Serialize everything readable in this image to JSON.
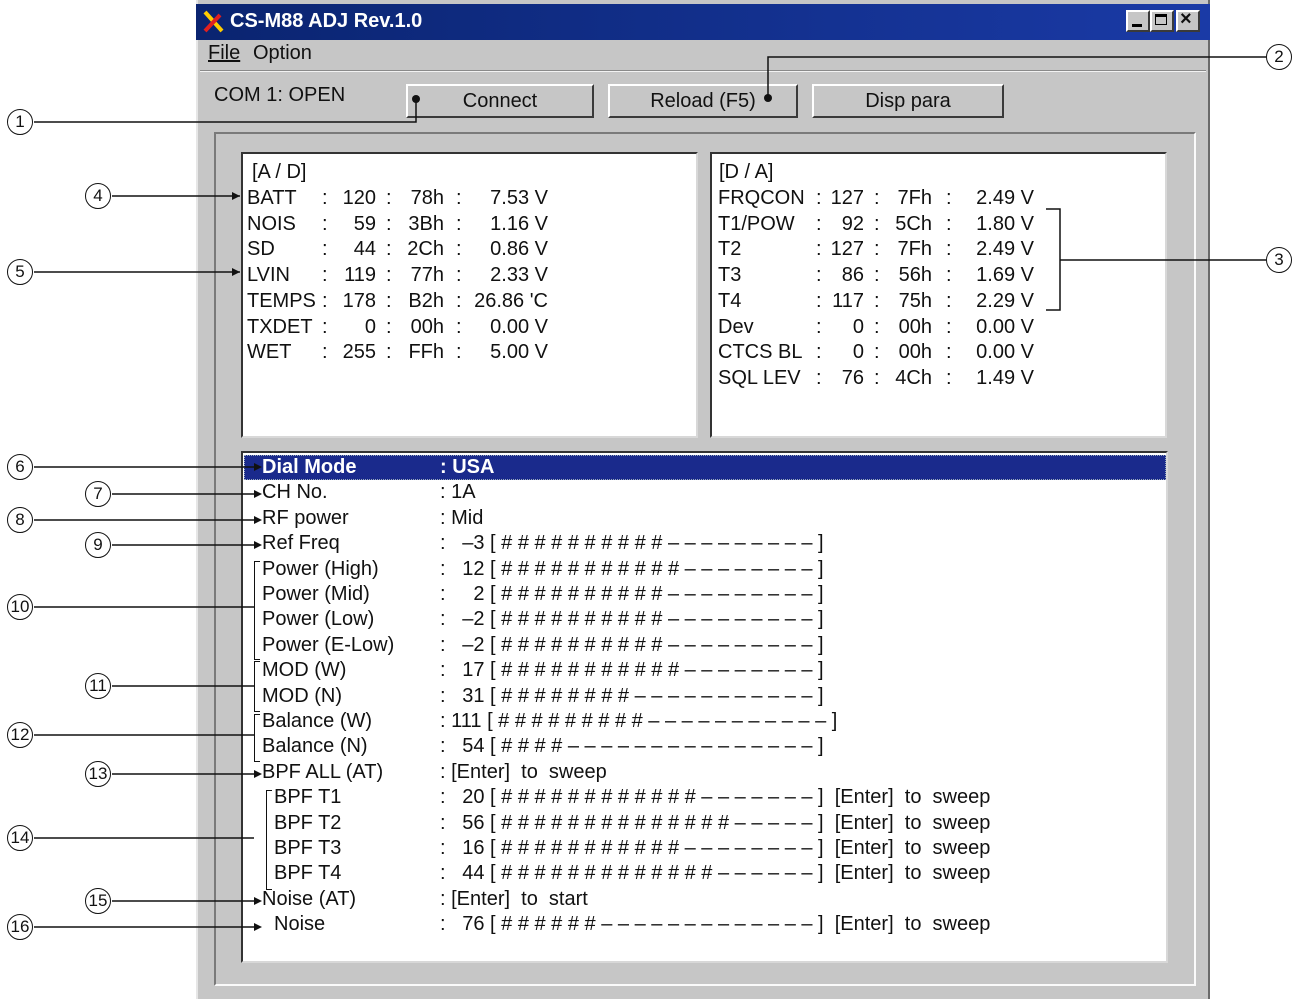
{
  "window": {
    "title": "CS-M88 ADJ Rev.1.0",
    "menu": [
      "File",
      "Option"
    ]
  },
  "toolbar": {
    "status": "COM 1: OPEN",
    "connect_label": "Connect",
    "reload_label": "Reload (F5)",
    "disp_label": "Disp  para"
  },
  "ad_panel": {
    "heading": "[A / D]",
    "rows": [
      {
        "name": "BATT",
        "sep": ":",
        "dec": "120",
        "hex": "78h",
        "volt": "7.53 V"
      },
      {
        "name": "NOIS",
        "sep": ":",
        "dec": "59",
        "hex": "3Bh",
        "volt": "1.16 V"
      },
      {
        "name": "SD",
        "sep": ":",
        "dec": "44",
        "hex": "2Ch",
        "volt": "0.86 V"
      },
      {
        "name": "LVIN",
        "sep": ":",
        "dec": "119",
        "hex": "77h",
        "volt": "2.33 V"
      },
      {
        "name": "TEMPS",
        "sep": ":",
        "dec": "178",
        "hex": "B2h",
        "volt": "26.86 'C"
      },
      {
        "name": "TXDET",
        "sep": ":",
        "dec": "0",
        "hex": "00h",
        "volt": "0.00 V"
      },
      {
        "name": "WET",
        "sep": ":",
        "dec": "255",
        "hex": "FFh",
        "volt": "5.00 V"
      }
    ]
  },
  "da_panel": {
    "heading": "[D / A]",
    "rows": [
      {
        "name": "FRQCON",
        "dec": "127",
        "hex": "7Fh",
        "volt": "2.49 V"
      },
      {
        "name": "T1/POW",
        "dec": "92",
        "hex": "5Ch",
        "volt": "1.80 V"
      },
      {
        "name": "T2",
        "dec": "127",
        "hex": "7Fh",
        "volt": "2.49 V"
      },
      {
        "name": "T3",
        "dec": "86",
        "hex": "56h",
        "volt": "1.69 V"
      },
      {
        "name": "T4",
        "dec": "117",
        "hex": "75h",
        "volt": "2.29 V"
      },
      {
        "name": "Dev",
        "dec": "0",
        "hex": "00h",
        "volt": "0.00 V"
      },
      {
        "name": "CTCS BL",
        "dec": "0",
        "hex": "00h",
        "volt": "0.00 V"
      },
      {
        "name": "SQL LEV",
        "dec": "76",
        "hex": "4Ch",
        "volt": "1.49 V"
      }
    ]
  },
  "adjust": {
    "rows": [
      {
        "label": "Dial Mode",
        "value": ": USA",
        "selected": true
      },
      {
        "label": "CH No.",
        "value": ": 1A"
      },
      {
        "label": "RF power",
        "value": ": Mid"
      },
      {
        "label": "Ref Freq",
        "value": ":   –3 [ # # # # # # # # # # – – – – – – – – – ]"
      },
      {
        "label": "Power (High)",
        "value": ":   12 [ # # # # # # # # # # # – – – – – – – – ]"
      },
      {
        "label": "Power (Mid)",
        "value": ":     2 [ # # # # # # # # # # – – – – – – – – – ]"
      },
      {
        "label": "Power (Low)",
        "value": ":   –2 [ # # # # # # # # # # – – – – – – – – – ]"
      },
      {
        "label": "Power (E-Low)",
        "value": ":   –2 [ # # # # # # # # # # – – – – – – – – – ]"
      },
      {
        "label": "MOD (W)",
        "value": ":   17 [ # # # # # # # # # # # – – – – – – – – ]"
      },
      {
        "label": "MOD (N)",
        "value": ":   31 [ # # # # # # # # – – – – – – – – – – – ]"
      },
      {
        "label": "Balance (W)",
        "value": ": 111 [ # # # # # # # # # – – – – – – – – – – – ]"
      },
      {
        "label": "Balance (N)",
        "value": ":   54 [ # # # # – – – – – – – – – – – – – – – ]"
      },
      {
        "label": "BPF ALL (AT)",
        "value": ": [Enter]  to  sweep"
      },
      {
        "label": "BPF T1",
        "value": ":   20 [ # # # # # # # # # # # # – – – – – – – ]  [Enter]  to  sweep"
      },
      {
        "label": "BPF T2",
        "value": ":   56 [ # # # # # # # # # # # # # # – – – – – ]  [Enter]  to  sweep"
      },
      {
        "label": "BPF T3",
        "value": ":   16 [ # # # # # # # # # # # – – – – – – – – ]  [Enter]  to  sweep"
      },
      {
        "label": "BPF T4",
        "value": ":   44 [ # # # # # # # # # # # # # – – – – – – ]  [Enter]  to  sweep"
      },
      {
        "label": "Noise (AT)",
        "value": ": [Enter]  to  start"
      },
      {
        "label": "Noise",
        "value": ":   76 [ # # # # # # – – – – – – – – – – – – – ]  [Enter]  to  sweep"
      }
    ]
  },
  "callouts": [
    "1",
    "2",
    "3",
    "4",
    "5",
    "6",
    "7",
    "8",
    "9",
    "10",
    "11",
    "12",
    "13",
    "14",
    "15",
    "16"
  ],
  "colors": {
    "titlebar": "#0a2470",
    "selection": "#1a2a8c",
    "window_bg": "#c6c6c6"
  }
}
